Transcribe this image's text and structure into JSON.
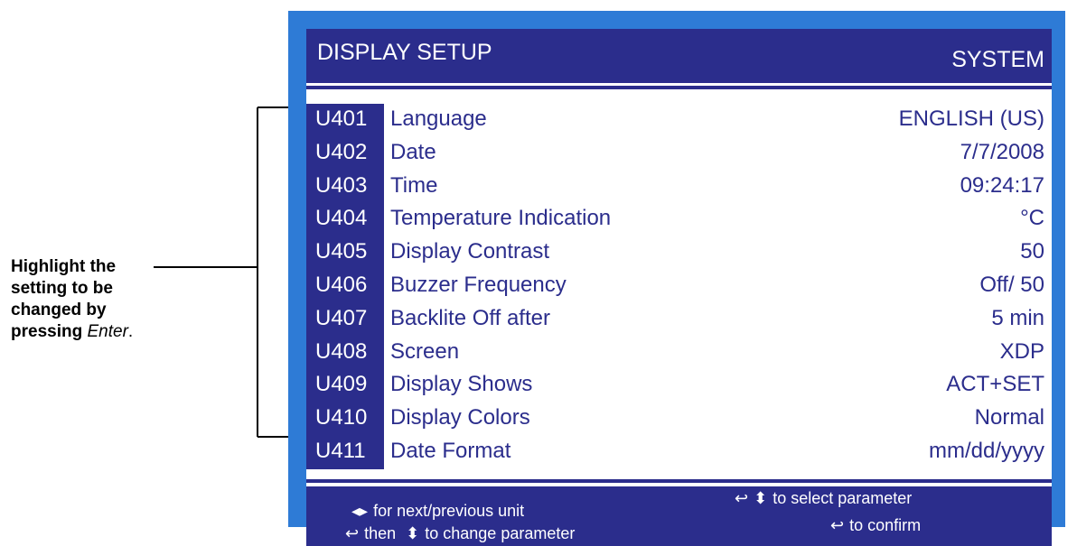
{
  "callout": {
    "line1": "Highlight the",
    "line2": "setting to be",
    "line3": "changed by",
    "line4_bold": "pressing",
    "line4_em": "Enter",
    "line4_end": "."
  },
  "header": {
    "title": "DISPLAY SETUP",
    "tag": "SYSTEM"
  },
  "rows": [
    {
      "code": "U401",
      "label": "Language",
      "value": "ENGLISH (US)"
    },
    {
      "code": "U402",
      "label": "Date",
      "value": "7/7/2008"
    },
    {
      "code": "U403",
      "label": "Time",
      "value": "09:24:17"
    },
    {
      "code": "U404",
      "label": "Temperature Indication",
      "value": "°C"
    },
    {
      "code": "U405",
      "label": "Display Contrast",
      "value": "50"
    },
    {
      "code": "U406",
      "label": "Buzzer Frequency",
      "value": "Off/ 50"
    },
    {
      "code": "U407",
      "label": "Backlite Off after",
      "value": "5 min"
    },
    {
      "code": "U408",
      "label": "Screen",
      "value": "XDP"
    },
    {
      "code": "U409",
      "label": "Display Shows",
      "value": "ACT+SET"
    },
    {
      "code": "U410",
      "label": "Display Colors",
      "value": "Normal"
    },
    {
      "code": "U411",
      "label": "Date Format",
      "value": "mm/dd/yyyy"
    }
  ],
  "footer": {
    "next_prev": "for next/previous unit",
    "then_change_a": "then",
    "then_change_b": "to change parameter",
    "select": "to select parameter",
    "confirm": "to confirm"
  },
  "colors": {
    "panel_border": "#2e7bd6",
    "bar": "#2b2d8c",
    "text": "#2b2d8c"
  },
  "icons": [
    "left-right-arrows-icon",
    "enter-icon",
    "up-down-arrows-icon",
    "pointer-arrow-icon"
  ]
}
